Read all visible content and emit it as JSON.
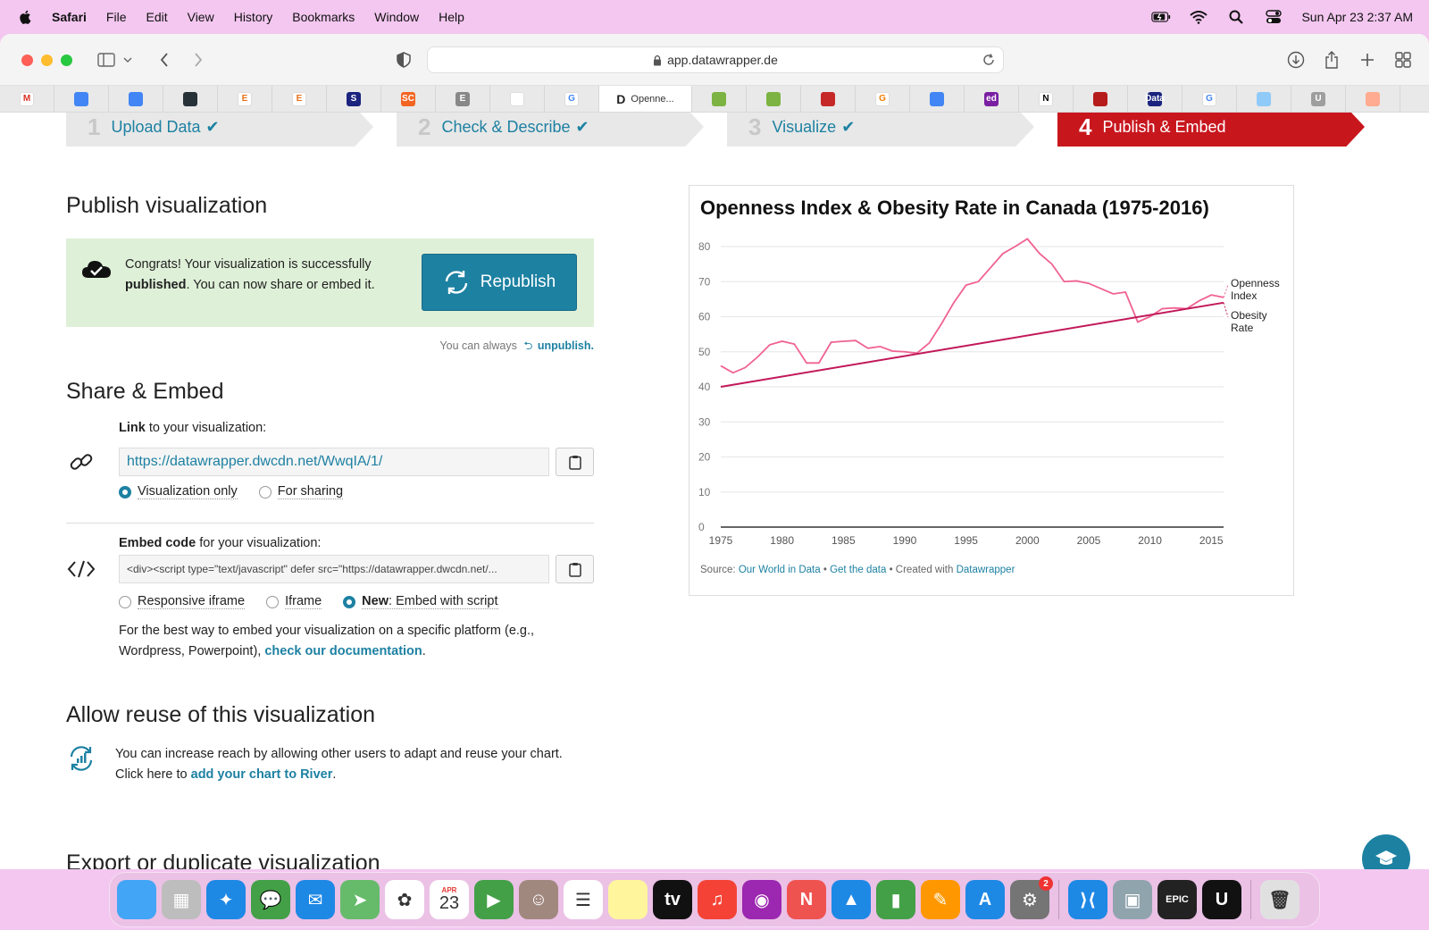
{
  "menubar": {
    "items": [
      "Safari",
      "File",
      "Edit",
      "View",
      "History",
      "Bookmarks",
      "Window",
      "Help"
    ],
    "datetime": "Sun Apr 23  2:37 AM"
  },
  "browser": {
    "url": "app.datawrapper.de",
    "active_tab_title": "Openne...",
    "favorites": [
      {
        "icon": "gmail-icon",
        "glyph": "M",
        "color": "#ffffff",
        "fg": "#d93025"
      },
      {
        "icon": "docs-icon",
        "glyph": "",
        "color": "#4285f4",
        "fg": "#fff"
      },
      {
        "icon": "docs-icon",
        "glyph": "",
        "color": "#4285f4",
        "fg": "#fff"
      },
      {
        "icon": "dark-bookmark-icon",
        "glyph": "",
        "color": "#263238",
        "fg": "#fff"
      },
      {
        "icon": "e-icon",
        "glyph": "E",
        "color": "#ffffff",
        "fg": "#e8711a"
      },
      {
        "icon": "e-icon",
        "glyph": "E",
        "color": "#ffffff",
        "fg": "#e8711a"
      },
      {
        "icon": "globe-icon",
        "glyph": "S",
        "color": "#1a237e",
        "fg": "#fff"
      },
      {
        "icon": "sc-icon",
        "glyph": "SC",
        "color": "#f26522",
        "fg": "#fff"
      },
      {
        "icon": "e-box-icon",
        "glyph": "E",
        "color": "#888888",
        "fg": "#fff"
      },
      {
        "icon": "edit-icon",
        "glyph": "",
        "color": "#ffffff",
        "fg": "#333"
      },
      {
        "icon": "google-icon",
        "glyph": "G",
        "color": "#ffffff",
        "fg": "#4285f4"
      }
    ],
    "favorites_right": [
      {
        "icon": "plant-icon",
        "glyph": "",
        "color": "#7cb342",
        "fg": "#fff"
      },
      {
        "icon": "plant-icon",
        "glyph": "",
        "color": "#7cb342",
        "fg": "#fff"
      },
      {
        "icon": "uk-flag-icon",
        "glyph": "",
        "color": "#c62828",
        "fg": "#fff"
      },
      {
        "icon": "g-orange-icon",
        "glyph": "G",
        "color": "#ffffff",
        "fg": "#f57c00"
      },
      {
        "icon": "docs-icon",
        "glyph": "",
        "color": "#4285f4",
        "fg": "#fff"
      },
      {
        "icon": "ed-icon",
        "glyph": "ed",
        "color": "#7b1fa2",
        "fg": "#fff"
      },
      {
        "icon": "notion-icon",
        "glyph": "N",
        "color": "#ffffff",
        "fg": "#000"
      },
      {
        "icon": "shield-cross-icon",
        "glyph": "",
        "color": "#b71c1c",
        "fg": "#fff"
      },
      {
        "icon": "data-icon",
        "glyph": "Data",
        "color": "#1a237e",
        "fg": "#fff"
      },
      {
        "icon": "google-icon",
        "glyph": "G",
        "color": "#ffffff",
        "fg": "#4285f4"
      },
      {
        "icon": "un-icon",
        "glyph": "",
        "color": "#90caf9",
        "fg": "#fff"
      },
      {
        "icon": "u-icon",
        "glyph": "U",
        "color": "#9e9e9e",
        "fg": "#fff"
      },
      {
        "icon": "swirl-icon",
        "glyph": "",
        "color": "#ffab91",
        "fg": "#fff"
      }
    ]
  },
  "steps": [
    {
      "num": "1",
      "label": "Upload Data",
      "check": "✔"
    },
    {
      "num": "2",
      "label": "Check & Describe",
      "check": "✔"
    },
    {
      "num": "3",
      "label": "Visualize",
      "check": "✔"
    },
    {
      "num": "4",
      "label": "Publish & Embed",
      "check": ""
    }
  ],
  "publish": {
    "heading": "Publish visualization",
    "msg_part1": "Congrats! Your visualization is successfully ",
    "msg_bold": "published",
    "msg_part2": ". You can now share or embed it.",
    "republish_label": "Republish",
    "unpublish_prefix": "You can always",
    "unpublish_link": "unpublish."
  },
  "share": {
    "heading": "Share & Embed",
    "link_label_bold": "Link",
    "link_label_rest": " to your visualization:",
    "link_url": "https://datawrapper.dwcdn.net/WwqIA/1/",
    "link_options": [
      "Visualization only",
      "For sharing"
    ],
    "embed_label_bold": "Embed code",
    "embed_label_rest": " for your visualization:",
    "embed_code": "<div><script type=\"text/javascript\" defer src=\"https://datawrapper.dwcdn.net/...",
    "embed_options": [
      "Responsive iframe",
      "Iframe",
      "Embed with script"
    ],
    "embed_new_prefix": "New",
    "embed_help_text": "For the best way to embed your visualization on a specific platform (e.g., Wordpress, Powerpoint), ",
    "embed_help_link": "check our documentation",
    "embed_help_end": "."
  },
  "reuse": {
    "heading": "Allow reuse of this visualization",
    "text": "You can increase reach by allowing other users to adapt and reuse your chart. Click here to ",
    "link": "add your chart to River",
    "end": "."
  },
  "export": {
    "heading": "Export or duplicate visualization"
  },
  "chart_data": {
    "type": "line",
    "title": "Openness Index & Obesity Rate in Canada (1975-2016)",
    "xlabel": "",
    "ylabel": "",
    "x_ticks": [
      1975,
      1980,
      1985,
      1990,
      1995,
      2000,
      2005,
      2010,
      2015
    ],
    "y_ticks": [
      0,
      10,
      20,
      30,
      40,
      50,
      60,
      70,
      80
    ],
    "xlim": [
      1975,
      2016
    ],
    "ylim": [
      0,
      80
    ],
    "grid": true,
    "legend": "right-end-labels",
    "series": [
      {
        "name": "Openness Index",
        "color": "#f06292",
        "x": [
          1975,
          1976,
          1977,
          1978,
          1979,
          1980,
          1981,
          1982,
          1983,
          1984,
          1985,
          1986,
          1987,
          1988,
          1989,
          1990,
          1991,
          1992,
          1993,
          1994,
          1995,
          1996,
          1997,
          1998,
          1999,
          2000,
          2001,
          2002,
          2003,
          2004,
          2005,
          2006,
          2007,
          2008,
          2009,
          2010,
          2011,
          2012,
          2013,
          2014,
          2015,
          2016
        ],
        "values": [
          46,
          44,
          45.5,
          48.5,
          52,
          53,
          52.2,
          46.8,
          46.8,
          52.7,
          53,
          53.2,
          51,
          51.5,
          50.2,
          50,
          49.6,
          52.5,
          58,
          64,
          69,
          70,
          74,
          78,
          80,
          82.2,
          78,
          75,
          70,
          70.2,
          69.5,
          68,
          66.5,
          67,
          58.5,
          60,
          62.3,
          62.5,
          62.3,
          64.5,
          66.2,
          65.5
        ]
      },
      {
        "name": "Obesity Rate",
        "color": "#c2185b",
        "x": [
          1975,
          2016
        ],
        "values": [
          40,
          64
        ]
      }
    ],
    "source_prefix": "Source: ",
    "source_link": "Our World in Data",
    "get_data": "Get the data",
    "created_prefix": "Created with ",
    "created_link": "Datawrapper"
  },
  "dock": {
    "apps": [
      {
        "name": "finder-icon",
        "color": "#42a5f5",
        "glyph": ""
      },
      {
        "name": "launchpad-icon",
        "color": "#bdbdbd",
        "glyph": "▦"
      },
      {
        "name": "safari-icon",
        "color": "#1e88e5",
        "glyph": "✦"
      },
      {
        "name": "messages-icon",
        "color": "#43a047",
        "glyph": "💬"
      },
      {
        "name": "mail-icon",
        "color": "#1e88e5",
        "glyph": "✉"
      },
      {
        "name": "maps-icon",
        "color": "#66bb6a",
        "glyph": "➤"
      },
      {
        "name": "photos-icon",
        "color": "#ffffff",
        "glyph": "✿"
      },
      {
        "name": "calendar-icon",
        "color": "#ffffff",
        "glyph": "23",
        "sub": "APR"
      },
      {
        "name": "facetime-icon",
        "color": "#43a047",
        "glyph": "▶"
      },
      {
        "name": "contacts-icon",
        "color": "#a1887f",
        "glyph": "☺"
      },
      {
        "name": "reminders-icon",
        "color": "#ffffff",
        "glyph": "☰"
      },
      {
        "name": "notes-icon",
        "color": "#fff59d",
        "glyph": ""
      },
      {
        "name": "tv-icon",
        "color": "#111111",
        "glyph": "tv"
      },
      {
        "name": "music-icon",
        "color": "#f44336",
        "glyph": "♫"
      },
      {
        "name": "podcasts-icon",
        "color": "#9c27b0",
        "glyph": "◉"
      },
      {
        "name": "news-icon",
        "color": "#ef5350",
        "glyph": "N"
      },
      {
        "name": "keynote-icon",
        "color": "#1e88e5",
        "glyph": "▲"
      },
      {
        "name": "numbers-icon",
        "color": "#43a047",
        "glyph": "▮"
      },
      {
        "name": "pages-icon",
        "color": "#ff9800",
        "glyph": "✎"
      },
      {
        "name": "appstore-icon",
        "color": "#1e88e5",
        "glyph": "A"
      },
      {
        "name": "settings-icon",
        "color": "#757575",
        "glyph": "⚙",
        "badge": "2"
      },
      {
        "name": "vscode-icon",
        "color": "#1e88e5",
        "glyph": "⟩⟨"
      },
      {
        "name": "preview-icon",
        "color": "#90a4ae",
        "glyph": "▣"
      },
      {
        "name": "epic-games-icon",
        "color": "#222222",
        "glyph": "EPIC"
      },
      {
        "name": "unreal-icon",
        "color": "#111111",
        "glyph": "U"
      },
      {
        "name": "trash-icon",
        "color": "#e0e0e0",
        "glyph": "🗑"
      }
    ]
  }
}
